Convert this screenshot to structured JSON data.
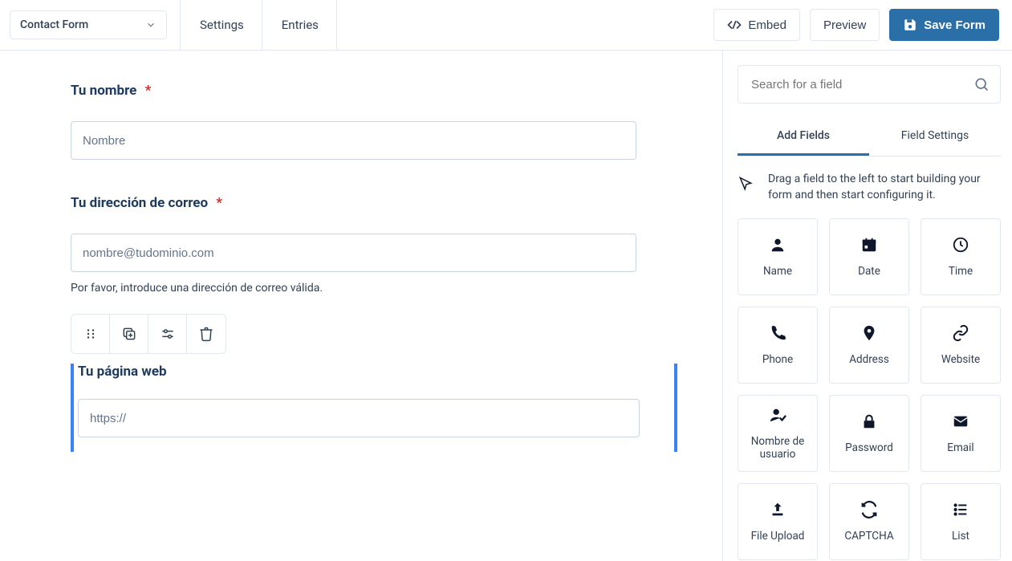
{
  "header": {
    "form_name": "Contact Form",
    "nav": {
      "settings": "Settings",
      "entries": "Entries"
    },
    "buttons": {
      "embed": "Embed",
      "preview": "Preview",
      "save": "Save Form"
    }
  },
  "canvas": {
    "fields": [
      {
        "label": "Tu nombre",
        "required": true,
        "placeholder": "Nombre",
        "helper": "",
        "selected": false
      },
      {
        "label": "Tu dirección de correo",
        "required": true,
        "placeholder": "nombre@tudominio.com",
        "helper": "Por favor, introduce una dirección de correo válida.",
        "selected": false
      },
      {
        "label": "Tu página web",
        "required": false,
        "placeholder": "https://",
        "helper": "",
        "selected": true
      }
    ]
  },
  "sidebar": {
    "search_placeholder": "Search for a field",
    "tabs": {
      "add": "Add Fields",
      "settings": "Field Settings"
    },
    "hint": "Drag a field to the left to start building your form and then start configuring it.",
    "fields": [
      {
        "label": "Name",
        "icon": "person"
      },
      {
        "label": "Date",
        "icon": "calendar"
      },
      {
        "label": "Time",
        "icon": "clock"
      },
      {
        "label": "Phone",
        "icon": "phone"
      },
      {
        "label": "Address",
        "icon": "pin"
      },
      {
        "label": "Website",
        "icon": "link"
      },
      {
        "label": "Nombre de usuario",
        "icon": "usercheck"
      },
      {
        "label": "Password",
        "icon": "lock"
      },
      {
        "label": "Email",
        "icon": "mail"
      },
      {
        "label": "File Upload",
        "icon": "upload"
      },
      {
        "label": "CAPTCHA",
        "icon": "refresh"
      },
      {
        "label": "List",
        "icon": "list"
      }
    ]
  }
}
